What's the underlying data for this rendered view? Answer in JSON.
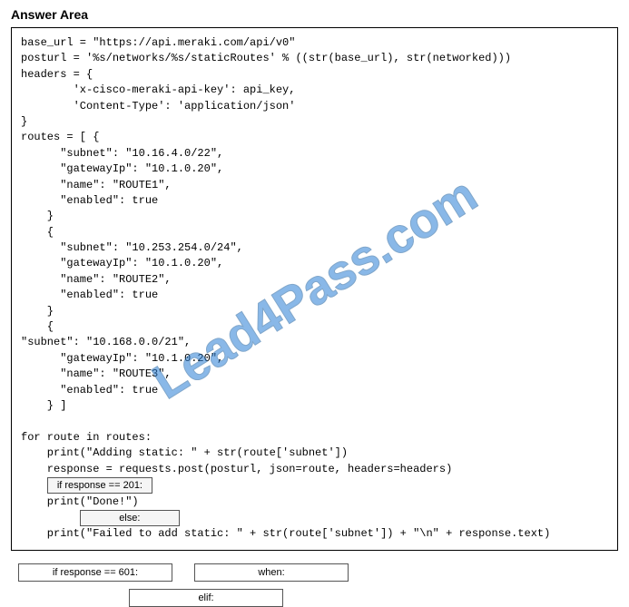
{
  "title": "Answer Area",
  "code": {
    "l1": "base_url = \"https://api.meraki.com/api/v0\"",
    "l2": "posturl = '%s/networks/%s/staticRoutes' % ((str(base_url), str(networked)))",
    "l3": "headers = {",
    "l4": "        'x-cisco-meraki-api-key': api_key,",
    "l5": "        'Content-Type': 'application/json'",
    "l6": "}",
    "l7": "routes = [ {",
    "l8": "      \"subnet\": \"10.16.4.0/22\",",
    "l9": "      \"gatewayIp\": \"10.1.0.20\",",
    "l10": "      \"name\": \"ROUTE1\",",
    "l11": "      \"enabled\": true",
    "l12": "    }",
    "l13": "    {",
    "l14": "      \"subnet\": \"10.253.254.0/24\",",
    "l15": "      \"gatewayIp\": \"10.1.0.20\",",
    "l16": "      \"name\": \"ROUTE2\",",
    "l17": "      \"enabled\": true",
    "l18": "    }",
    "l19": "    {",
    "l20": "\"subnet\": \"10.168.0.0/21\",",
    "l21": "      \"gatewayIp\": \"10.1.0.20\",",
    "l22": "      \"name\": \"ROUTE3\",",
    "l23": "      \"enabled\": true",
    "l24": "    } ]",
    "l25": "",
    "l26": "for route in routes:",
    "l27": "    print(\"Adding static: \" + str(route['subnet'])",
    "l28": "    response = requests.post(posturl, json=route, headers=headers)",
    "slot1": "if response == 201:",
    "l30": "    print(\"Done!\")",
    "slot2": "else:",
    "l32": "    print(\"Failed to add static: \" + str(route['subnet']) + \"\\n\" + response.text)"
  },
  "options": {
    "opt1": "if response == 601:",
    "opt2": "when:",
    "opt3": "elif:"
  },
  "watermark": "Lead4Pass.com"
}
